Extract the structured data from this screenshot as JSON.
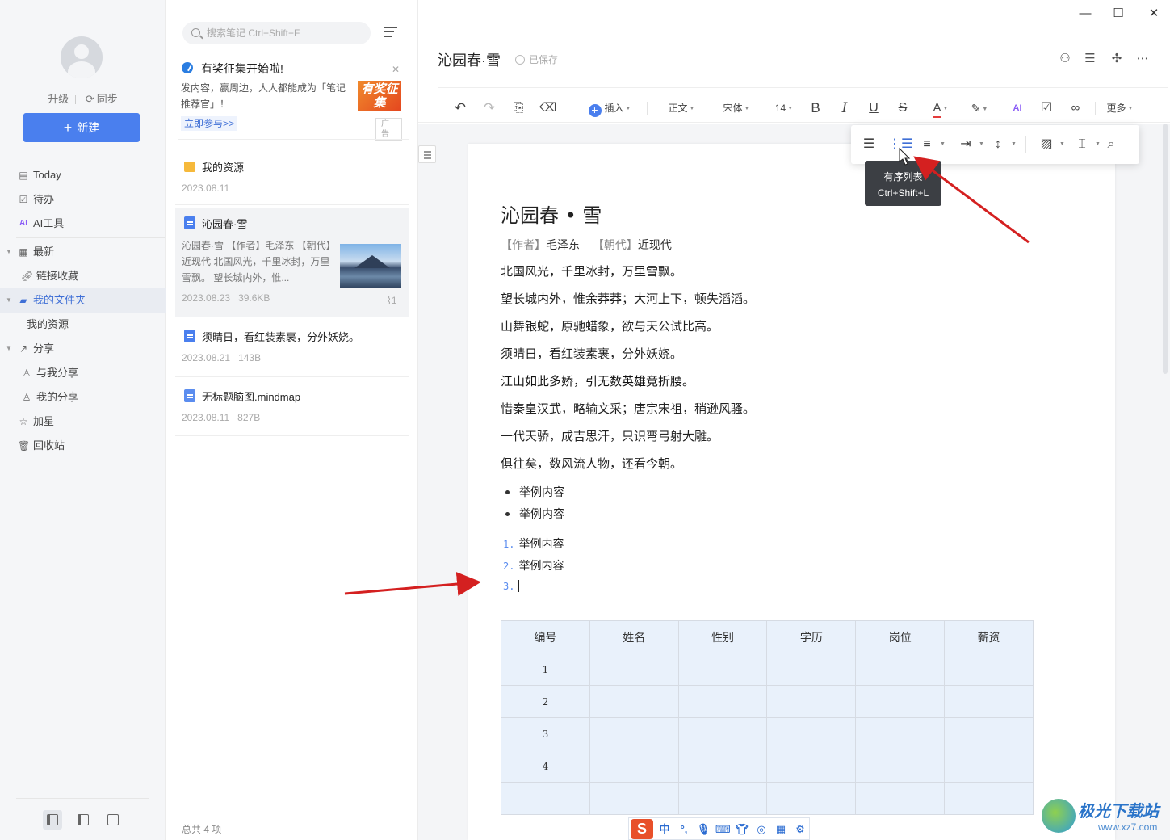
{
  "sidebar": {
    "upgrade": "升级",
    "sync": "同步",
    "new_button": "新建",
    "items": [
      {
        "label": "Today",
        "icon": "calendar-icon"
      },
      {
        "label": "待办",
        "icon": "checkbox-icon"
      },
      {
        "label": "AI工具",
        "icon": "ai-icon"
      },
      {
        "label": "最新",
        "icon": "grid-icon"
      },
      {
        "label": "链接收藏",
        "icon": "link-icon"
      },
      {
        "label": "我的文件夹",
        "icon": "folder-icon"
      },
      {
        "label": "我的资源",
        "icon": ""
      },
      {
        "label": "分享",
        "icon": "share-icon"
      },
      {
        "label": "与我分享",
        "icon": "user-icon"
      },
      {
        "label": "我的分享",
        "icon": "user-icon"
      },
      {
        "label": "加星",
        "icon": "star-icon"
      },
      {
        "label": "回收站",
        "icon": "trash-icon"
      }
    ]
  },
  "list": {
    "search_placeholder": "搜索笔记 Ctrl+Shift+F",
    "ad": {
      "title": "有奖征集开始啦!",
      "text": "发内容，赢周边，人人都能成为「笔记推荐官」！",
      "image_text": "有奖征集",
      "link": "立即参与>>",
      "tag": "广告"
    },
    "notes": [
      {
        "title": "我的资源",
        "date": "2023.08.11",
        "size": "",
        "type": "folder"
      },
      {
        "title": "沁园春·雪",
        "date": "2023.08.23",
        "size": "39.6KB",
        "type": "doc",
        "snippet": "沁园春·雪 【作者】毛泽东 【朝代】近现代 北国风光，千里冰封，万里雪飘。 望长城内外，惟...",
        "attachments": "1"
      },
      {
        "title": "须晴日，看红装素裹，分外妖娆。",
        "date": "2023.08.21",
        "size": "143B",
        "type": "doc"
      },
      {
        "title": "无标题脑图.mindmap",
        "date": "2023.08.11",
        "size": "827B",
        "type": "mindmap"
      }
    ],
    "footer": "总共 4 项"
  },
  "editor": {
    "title": "沁园春·雪",
    "saved": "已保存",
    "toolbar": {
      "insert": "插入",
      "style": "正文",
      "font": "宋体",
      "size": "14",
      "bold": "B",
      "italic": "I",
      "underline": "U",
      "strike": "S",
      "color": "A",
      "more": "更多"
    },
    "tooltip": {
      "line1": "有序列表",
      "line2": "Ctrl+Shift+L"
    },
    "document": {
      "heading": "沁园春 • 雪",
      "author_label": "【作者】",
      "author": "毛泽东",
      "dynasty_label": "【朝代】",
      "dynasty": "近现代",
      "lines": [
        "北国风光，千里冰封，万里雪飘。",
        "望长城内外，惟余莽莽；大河上下，顿失滔滔。",
        "山舞银蛇，原驰蜡象，欲与天公试比高。",
        "须晴日，看红装素裹，分外妖娆。",
        "江山如此多娇，引无数英雄竞折腰。",
        "惜秦皇汉武，略输文采；唐宗宋祖，稍逊风骚。",
        "一代天骄，成吉思汗，只识弯弓射大雕。",
        "俱往矣，数风流人物，还看今朝。"
      ],
      "bullets": [
        "举例内容",
        "举例内容"
      ],
      "ordered": [
        {
          "num": "1.",
          "text": "举例内容"
        },
        {
          "num": "2.",
          "text": "举例内容"
        },
        {
          "num": "3.",
          "text": ""
        }
      ],
      "table": {
        "headers": [
          "编号",
          "姓名",
          "性别",
          "学历",
          "岗位",
          "薪资"
        ],
        "rows": [
          [
            "1",
            "",
            "",
            "",
            "",
            ""
          ],
          [
            "2",
            "",
            "",
            "",
            "",
            ""
          ],
          [
            "3",
            "",
            "",
            "",
            "",
            ""
          ],
          [
            "4",
            "",
            "",
            "",
            "",
            ""
          ],
          [
            "",
            "",
            "",
            "",
            "",
            ""
          ]
        ]
      }
    }
  },
  "ime": {
    "logo": "S",
    "mode": "中"
  },
  "watermark": {
    "name": "极光下载站",
    "url": "www.xz7.com"
  },
  "colors": {
    "accent": "#4a7fee",
    "arrow": "#d42020",
    "table_fill": "#e9f1fb"
  }
}
